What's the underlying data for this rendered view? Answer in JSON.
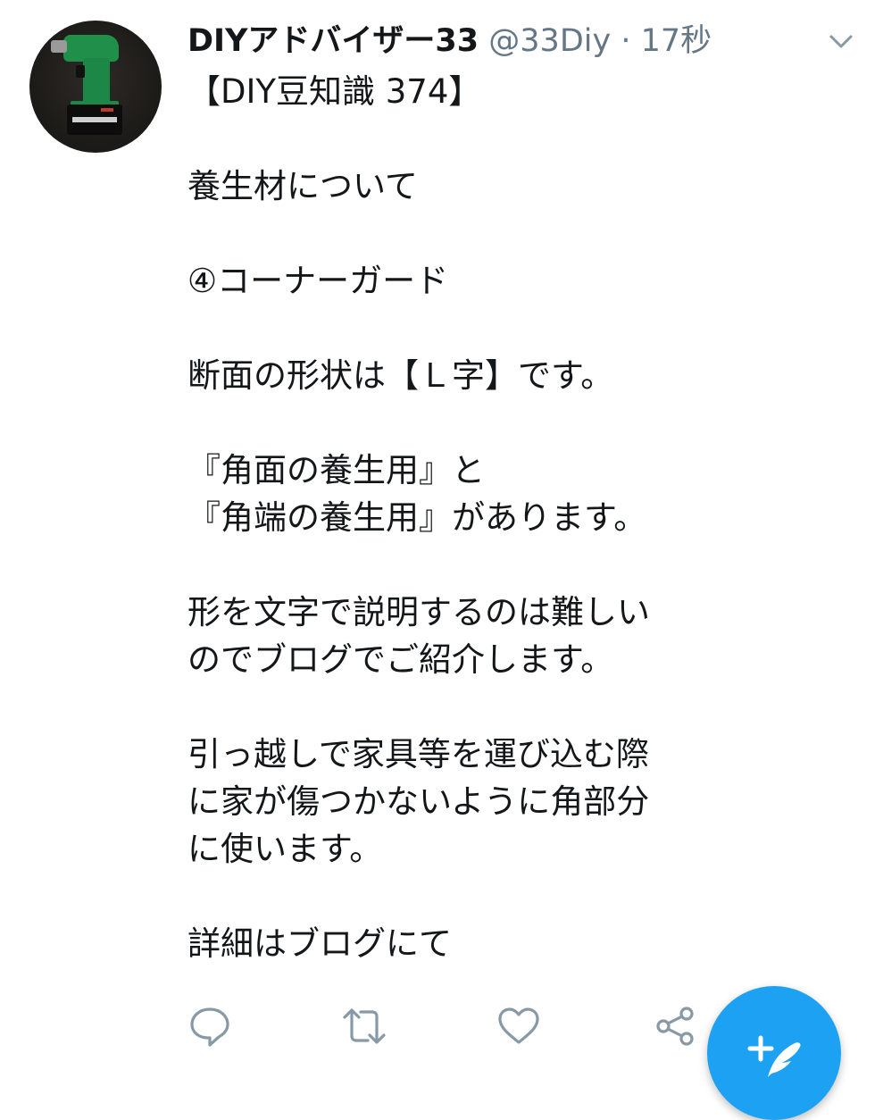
{
  "tweet": {
    "display_name": "DIYアドバイザー33",
    "handle": "@33Diy",
    "separator": " · ",
    "time": "17秒",
    "text": "【DIY豆知識 374】\n\n養生材について\n\n④コーナーガード\n\n断面の形状は【Ｌ字】です。\n\n『角面の養生用』と\n『角端の養生用』があります。\n\n形を文字で説明するのは難しい\nのでブログでご紹介します。\n\n引っ越しで家具等を運び込む際\nに家が傷つかないように角部分\nに使います。\n\n詳細はブログにて"
  },
  "actions": {
    "icons": [
      "reply-icon",
      "retweet-icon",
      "like-icon",
      "share-icon"
    ]
  },
  "fab": {
    "icon": "compose-tweet-icon"
  },
  "colors": {
    "accent": "#1da1f2",
    "text": "#14171a",
    "secondary": "#657786"
  }
}
